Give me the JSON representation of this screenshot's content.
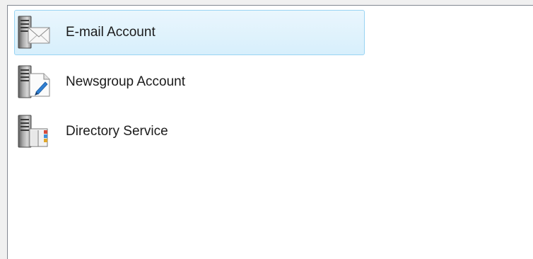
{
  "account_types": {
    "items": [
      {
        "label": "E-mail Account",
        "icon": "email-server-icon",
        "selected": true
      },
      {
        "label": "Newsgroup Account",
        "icon": "newsgroup-server-icon",
        "selected": false
      },
      {
        "label": "Directory Service",
        "icon": "directory-server-icon",
        "selected": false
      }
    ],
    "colors": {
      "selection_fill": "#d7effc",
      "selection_border": "#99d4f3",
      "border": "#828790"
    }
  }
}
